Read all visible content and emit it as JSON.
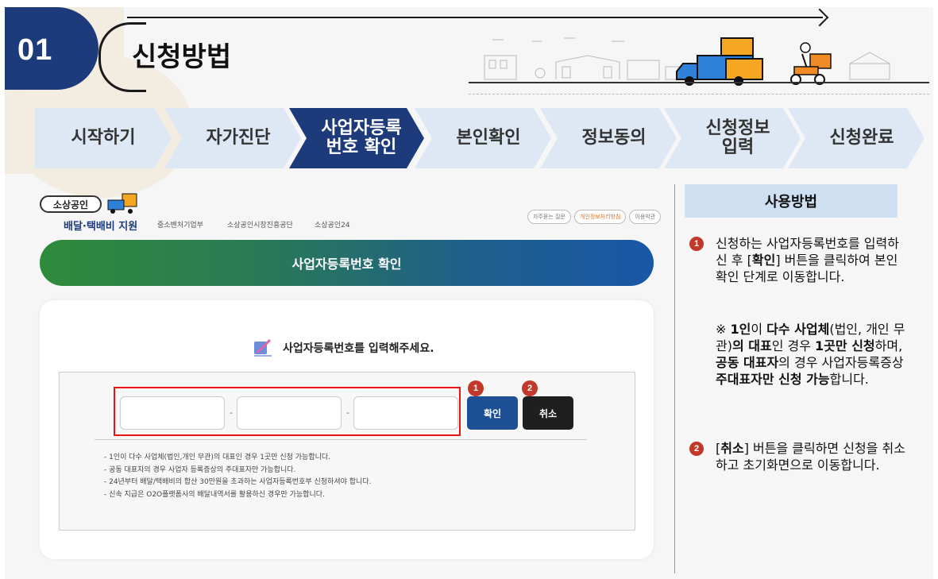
{
  "header": {
    "number": "01",
    "title": "신청방법"
  },
  "steps": [
    {
      "label": "시작하기",
      "active": false
    },
    {
      "label": "자가진단",
      "active": false
    },
    {
      "label": "사업자등록\n번호 확인",
      "active": true
    },
    {
      "label": "본인확인",
      "active": false
    },
    {
      "label": "정보동의",
      "active": false
    },
    {
      "label": "신청정보\n입력",
      "active": false
    },
    {
      "label": "신청완료",
      "active": false
    }
  ],
  "left": {
    "logo_pill": "소상공인",
    "logo_text": "배달·택배비 지원",
    "orgs": [
      "중소벤처기업부",
      "소상공인시장진흥공단",
      "소상공인24"
    ],
    "top_buttons": [
      "자주묻는 질문",
      "개인정보처리방침",
      "이용약관"
    ],
    "banner": "사업자등록번호 확인",
    "prompt": "사업자등록번호를 입력해주세요.",
    "ok_button": "확인",
    "cancel_button": "취소",
    "badge1": "1",
    "badge2": "2",
    "notes": [
      "- 1인이 다수 사업체(법인,개인 무관)의 대표인 경우 1곳만 신청 가능합니다.",
      "- 공동 대표자의 경우 사업자 등록증상의 주대표자만 가능합니다.",
      "- 24년부터 배달/택배비의 합산 30만원을 초과하는 사업자등록번호부 신청하셔야 합니다.",
      "- 신속 지급은 O2O플랫폼사의 배달내역서를 활용하신 경우만 가능합니다."
    ]
  },
  "right": {
    "title": "사용방법",
    "item1_badge": "1",
    "item1_text_a": "신청하는 사업자등록번호를 입력하신 후 [",
    "item1_bold": "확인",
    "item1_text_b": "] 버튼을 클릭하여 본인 확인 단계로 이동합니다.",
    "note_a": "※ ",
    "note_b1": "1인",
    "note_c": "이 ",
    "note_b2": "다수 사업체",
    "note_d": "(법인, 개인 무관)",
    "note_b3": "의 대표",
    "note_e": "인 경우 ",
    "note_b4": "1곳만 신청",
    "note_f": "하며, ",
    "note_b5": "공동 대표자",
    "note_g": "의 경우 사업자등록증상 ",
    "note_b6": "주대표자만 신청 가능",
    "note_h": "합니다.",
    "item2_badge": "2",
    "item2_text_a": "[",
    "item2_bold": "취소",
    "item2_text_b": "] 버튼을 클릭하면 신청을 취소하고 초기화면으로 이동합니다."
  },
  "colors": {
    "navy": "#1d3b7a",
    "step_active": "#1d3b7a",
    "step_inactive": "#dde8f4",
    "badge_red": "#c0392b",
    "howto_bg": "#cfe0f3"
  }
}
